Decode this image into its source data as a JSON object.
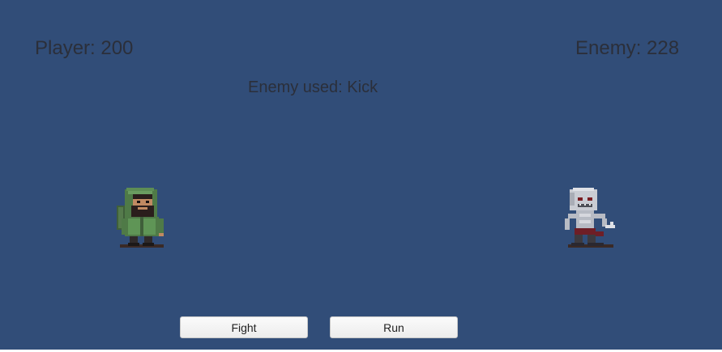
{
  "hud": {
    "player_label": "Player: 200",
    "enemy_label": "Enemy: 228",
    "battle_log": "Enemy used: Kick"
  },
  "player": {
    "hp": 200,
    "sprite": "hooded-bearded-adventurer-icon"
  },
  "enemy": {
    "hp": 228,
    "sprite": "pale-zombie-icon",
    "last_move": "Kick"
  },
  "actions": {
    "fight_label": "Fight",
    "run_label": "Run"
  },
  "colors": {
    "background": "#314d78",
    "hud_text": "#2b2f3a",
    "button_face": "#f2f2f2"
  }
}
